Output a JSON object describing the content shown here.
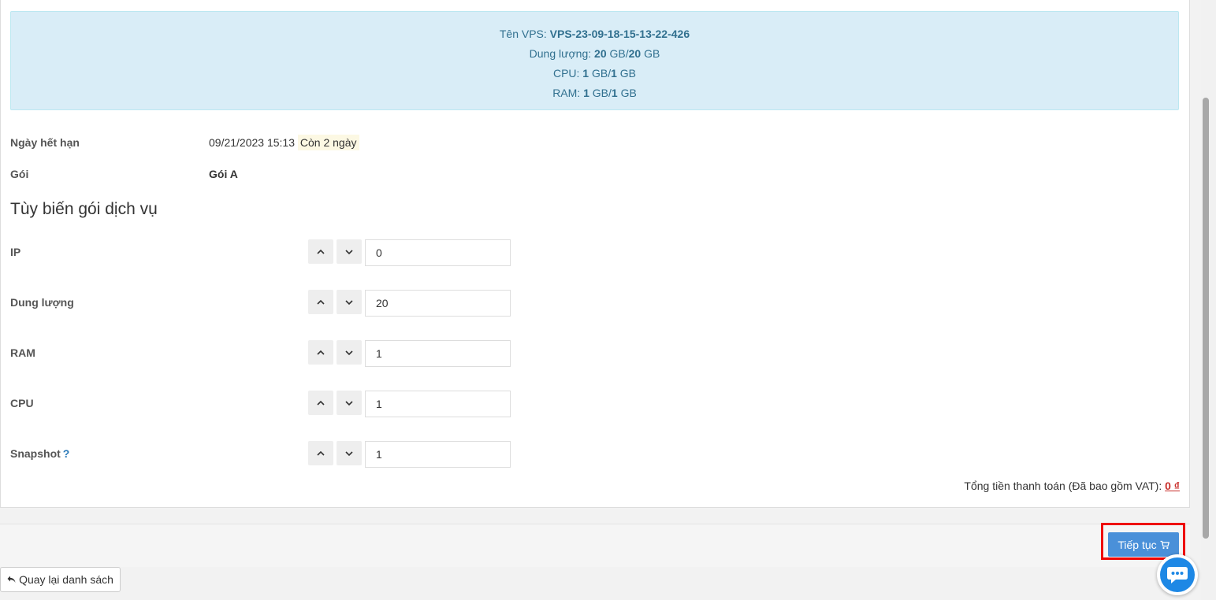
{
  "vps_info": {
    "name_label": "Tên VPS: ",
    "name_value": "VPS-23-09-18-15-13-22-426",
    "storage_label": "Dung lượng: ",
    "storage_used": "20",
    "storage_sep": " GB/",
    "storage_total": "20",
    "storage_unit": " GB",
    "cpu_label": "CPU: ",
    "cpu_used": "1",
    "cpu_sep": " GB/",
    "cpu_total": "1",
    "cpu_unit": " GB",
    "ram_label": "RAM: ",
    "ram_used": "1",
    "ram_sep": " GB/",
    "ram_total": "1",
    "ram_unit": " GB"
  },
  "details": {
    "expiry_label": "Ngày hết hạn",
    "expiry_value": "09/21/2023 15:13",
    "expiry_badge": "Còn 2 ngày",
    "package_label": "Gói",
    "package_value": "Gói A"
  },
  "customize": {
    "title": "Tùy biến gói dịch vụ",
    "ip_label": "IP",
    "ip_value": "0",
    "storage_label": "Dung lượng",
    "storage_value": "20",
    "ram_label": "RAM",
    "ram_value": "1",
    "cpu_label": "CPU",
    "cpu_value": "1",
    "snapshot_label": "Snapshot",
    "snapshot_help": "?",
    "snapshot_value": "1"
  },
  "total": {
    "label": "Tổng tiền thanh toán (Đã bao gồm VAT): ",
    "amount": "0 ₫"
  },
  "actions": {
    "continue_label": "Tiếp tục",
    "back_label": "Quay lại danh sách"
  },
  "colors": {
    "info_bg": "#d9edf7",
    "info_text": "#31708f",
    "primary": "#4a90d9",
    "highlight": "#ee0000",
    "amount": "#c9302c"
  }
}
